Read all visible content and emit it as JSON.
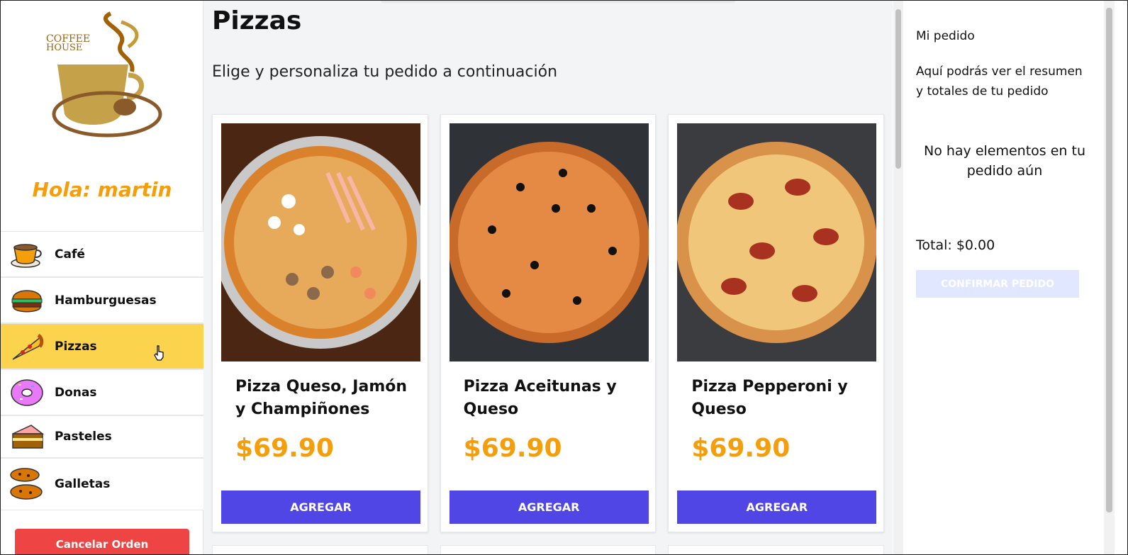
{
  "brand": {
    "logo_line1": "COFFEE",
    "logo_line2": "HOUSE"
  },
  "greeting": "Hola: martin",
  "categories": [
    {
      "label": "Café",
      "icon": "coffee-cup-icon",
      "active": false
    },
    {
      "label": "Hamburguesas",
      "icon": "burger-icon",
      "active": false
    },
    {
      "label": "Pizzas",
      "icon": "pizza-slice-icon",
      "active": true
    },
    {
      "label": "Donas",
      "icon": "donut-icon",
      "active": false
    },
    {
      "label": "Pasteles",
      "icon": "cake-slice-icon",
      "active": false
    },
    {
      "label": "Galletas",
      "icon": "cookies-icon",
      "active": false
    }
  ],
  "cancel_label": "Cancelar Orden",
  "main": {
    "title": "Pizzas",
    "subtitle": "Elige y personaliza tu pedido a continuación",
    "products": [
      {
        "name": "Pizza Queso, Jamón y Champiñones",
        "price": "$69.90",
        "button": "AGREGAR"
      },
      {
        "name": "Pizza Aceitunas y Queso",
        "price": "$69.90",
        "button": "AGREGAR"
      },
      {
        "name": "Pizza Pepperoni y Queso",
        "price": "$69.90",
        "button": "AGREGAR"
      }
    ]
  },
  "order": {
    "title": "Mi pedido",
    "description": "Aquí podrás ver el resumen y totales de tu pedido",
    "empty": "No hay elementos en tu pedido aún",
    "total": "Total: $0.00",
    "confirm": "CONFIRMAR PEDIDO"
  },
  "colors": {
    "accent": "#f59e0b",
    "active_category": "#fcd34d",
    "primary_button": "#4f46e5",
    "cancel": "#ef4444",
    "confirm_disabled": "#e0e7ff"
  }
}
